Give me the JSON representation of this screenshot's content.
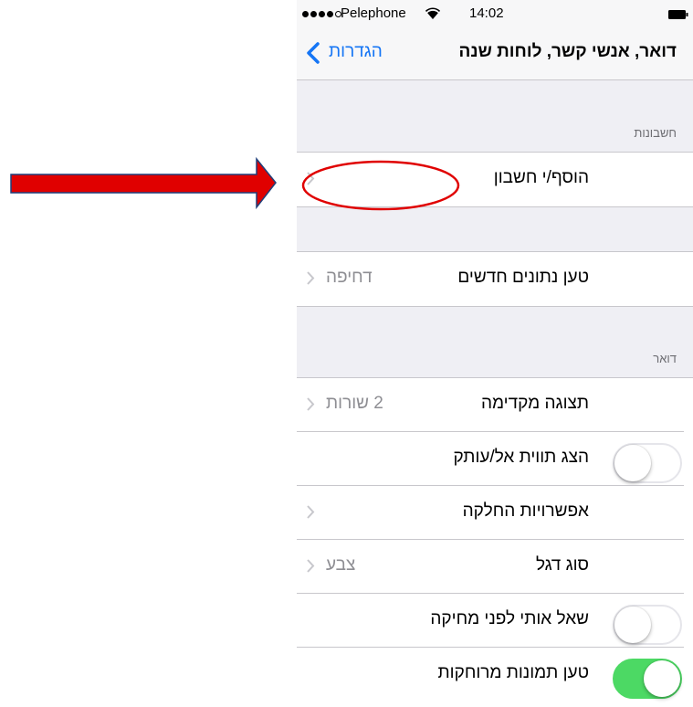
{
  "status_bar": {
    "signal_bars_filled": 4,
    "signal_bars_total": 5,
    "carrier": "Pelephone",
    "wifi_icon": "wifi-icon",
    "time": "14:02",
    "battery_icon": "battery-icon"
  },
  "nav": {
    "back_label": "הגדרות",
    "title": "דואר, אנשי קשר, לוחות שנה"
  },
  "sections": {
    "accounts_header": "חשבונות",
    "add_account_label": "הוסף/י חשבון",
    "fetch_label": "טען נתונים חדשים",
    "fetch_value": "דחיפה",
    "mail_header": "דואר",
    "preview_label": "תצוגה מקדימה",
    "preview_value": "2 שורות",
    "show_to_cc_label": "הצג תווית אל/עותק",
    "show_to_cc_on": false,
    "swipe_label": "אפשרויות החלקה",
    "flag_label": "סוג דגל",
    "flag_value": "צבע",
    "ask_delete_label": "שאל אותי לפני מחיקה",
    "ask_delete_on": false,
    "load_images_label": "טען תמונות מרוחקות",
    "load_images_on": true
  },
  "annotations": {
    "arrow_color": "#e00000",
    "circle_color": "#e00000"
  },
  "colors": {
    "ios_blue": "#1575f5",
    "switch_green": "#4cd964",
    "grouped_bg": "#efeff4"
  }
}
